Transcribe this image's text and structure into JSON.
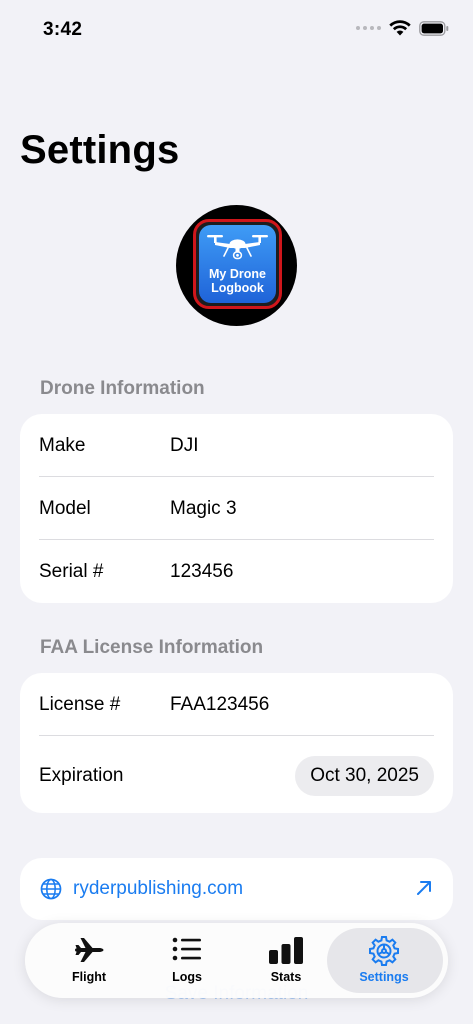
{
  "status_bar": {
    "time": "3:42"
  },
  "page_title": "Settings",
  "logo": {
    "line1": "My Drone",
    "line2": "Logbook"
  },
  "drone_section": {
    "header": "Drone Information",
    "rows": [
      {
        "label": "Make",
        "value": "DJI"
      },
      {
        "label": "Model",
        "value": "Magic 3"
      },
      {
        "label": "Serial #",
        "value": "123456"
      }
    ]
  },
  "faa_section": {
    "header": "FAA License Information",
    "license_label": "License #",
    "license_value": "FAA123456",
    "expiration_label": "Expiration",
    "expiration_value": "Oct 30, 2025"
  },
  "website": {
    "url": "ryderpublishing.com"
  },
  "save_button": {
    "label": "Save Information"
  },
  "tab_bar": {
    "tabs": [
      {
        "label": "Flight",
        "icon": "airplane-icon"
      },
      {
        "label": "Logs",
        "icon": "list-icon"
      },
      {
        "label": "Stats",
        "icon": "bar-chart-icon"
      },
      {
        "label": "Settings",
        "icon": "gear-icon"
      }
    ],
    "active": "Settings"
  },
  "colors": {
    "background": "#f2f2f7",
    "accent": "#1a7cf0",
    "card": "#ffffff",
    "secondary_text": "#8a8a8e",
    "logo_border": "#d0161b"
  }
}
